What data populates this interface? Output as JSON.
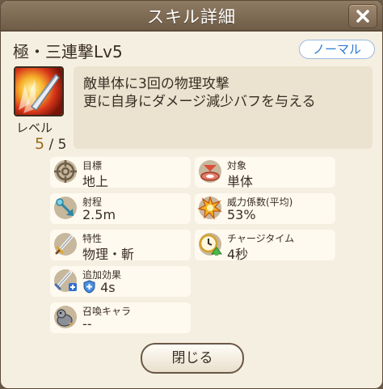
{
  "dialog": {
    "title": "スキル詳細"
  },
  "skill": {
    "name": "極・三連撃Lv5",
    "rarity": "ノーマル",
    "level_label": "レベル",
    "level_current": "5",
    "level_max": "/ 5",
    "description": [
      "敵単体に3回の物理攻撃",
      "更に自身にダメージ減少バフを与える"
    ]
  },
  "stats": {
    "target": {
      "label": "目標",
      "value": "地上",
      "icon": "crosshair-icon"
    },
    "subject": {
      "label": "対象",
      "value": "単体",
      "icon": "target-ring-icon"
    },
    "range": {
      "label": "射程",
      "value": "2.5m",
      "icon": "range-arrow-icon"
    },
    "power": {
      "label": "威力係数(平均)",
      "value": "53%",
      "icon": "burst-icon"
    },
    "attribute": {
      "label": "特性",
      "value": "物理・斬",
      "icon": "sword-icon"
    },
    "charge": {
      "label": "チャージタイム",
      "value": "4秒",
      "icon": "clock-icon"
    },
    "extra": {
      "label": "追加効果",
      "value": "4s",
      "icon": "sword-plus-icon",
      "badge_icon": "shield-plus-icon"
    },
    "summon": {
      "label": "召喚キャラ",
      "value": "--",
      "icon": "summon-creature-icon"
    }
  },
  "footer": {
    "close_label": "閉じる"
  }
}
